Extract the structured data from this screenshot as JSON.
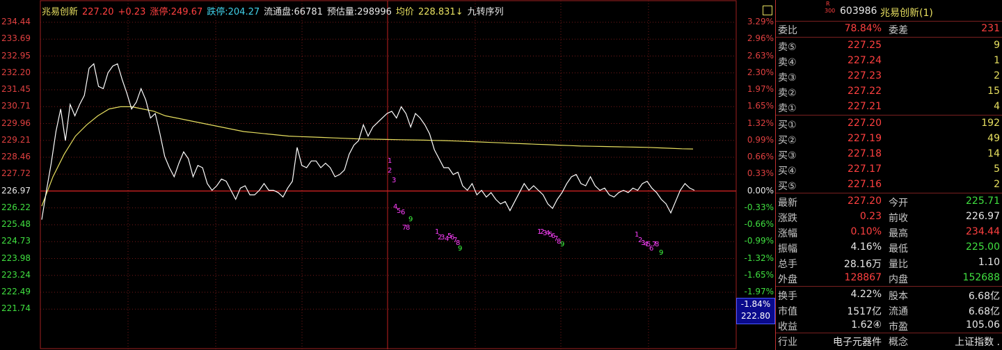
{
  "header": {
    "name": "兆易创新",
    "price": "227.20",
    "change": "+0.23",
    "limit_up_label": "涨停:",
    "limit_up": "249.67",
    "limit_down_label": "跌停:",
    "limit_down": "204.27",
    "float_label": "流通盘:",
    "float": "66781",
    "estimate_label": "预估量:",
    "estimate": "298996",
    "avg_label": "均价",
    "avg": "228.831↓",
    "seq_label": "九转序列"
  },
  "left_axis": [
    "234.44",
    "233.69",
    "232.95",
    "232.20",
    "231.45",
    "230.71",
    "229.96",
    "229.21",
    "228.46",
    "227.72",
    "226.97",
    "226.22",
    "225.48",
    "224.73",
    "223.98",
    "223.24",
    "222.49",
    "221.74"
  ],
  "right_axis": [
    "3.29%",
    "2.96%",
    "2.63%",
    "2.30%",
    "1.97%",
    "1.65%",
    "1.32%",
    "0.99%",
    "0.66%",
    "0.33%",
    "0.00%",
    "-0.33%",
    "-0.66%",
    "-0.99%",
    "-1.32%",
    "-1.65%",
    "-1.97%"
  ],
  "cursor": {
    "pct": "-1.84%",
    "price": "222.80"
  },
  "chart_data": {
    "type": "line",
    "title": "",
    "ylim": [
      221.74,
      234.44
    ],
    "prev_close": 226.97,
    "series": [
      {
        "name": "price",
        "values": [
          225.7,
          227.0,
          228.2,
          229.6,
          230.6,
          229.2,
          230.8,
          230.3,
          230.8,
          231.2,
          232.4,
          232.6,
          231.6,
          231.5,
          232.2,
          232.5,
          232.6,
          231.9,
          231.3,
          230.6,
          230.9,
          231.5,
          231.0,
          230.2,
          230.4,
          229.5,
          228.5,
          228.0,
          227.6,
          228.2,
          228.7,
          228.4,
          227.6,
          228.1,
          228.0,
          227.3,
          227.0,
          227.2,
          227.5,
          227.4,
          227.0,
          226.6,
          227.1,
          227.2,
          226.8,
          226.8,
          227.0,
          227.3,
          227.0,
          227.0,
          226.9,
          226.7,
          227.1,
          227.4,
          228.9,
          228.1,
          228.0,
          228.3,
          228.3,
          228.0,
          228.2,
          228.0,
          227.6,
          227.7,
          227.9,
          228.6,
          229.0,
          229.2,
          229.9,
          229.4,
          229.8,
          230.0,
          230.2,
          230.4,
          230.5,
          230.2,
          230.7,
          230.4,
          229.8,
          230.4,
          230.2,
          229.9,
          229.5,
          228.8,
          228.4,
          228.0,
          228.0,
          227.7,
          227.8,
          227.2,
          227.0,
          227.3,
          226.8,
          227.0,
          226.7,
          226.9,
          226.6,
          226.4,
          226.5,
          226.1,
          226.5,
          226.9,
          227.3,
          227.0,
          227.2,
          227.0,
          226.8,
          226.4,
          226.2,
          226.6,
          226.9,
          227.3,
          227.6,
          227.7,
          227.3,
          227.2,
          227.6,
          227.2,
          227.0,
          227.1,
          226.8,
          226.7,
          226.9,
          227.0,
          226.9,
          227.1,
          227.0,
          227.3,
          227.4,
          227.1,
          226.9,
          226.6,
          226.4,
          226.0,
          226.5,
          227.0,
          227.3,
          227.1,
          227.0
        ]
      },
      {
        "name": "avg",
        "values": [
          226.3,
          227.6,
          228.6,
          229.4,
          229.9,
          230.3,
          230.6,
          230.7,
          230.7,
          230.6,
          230.5,
          230.3,
          230.2,
          230.1,
          230.0,
          229.9,
          229.8,
          229.7,
          229.6,
          229.55,
          229.5,
          229.45,
          229.4,
          229.38,
          229.36,
          229.34,
          229.32,
          229.3,
          229.28,
          229.27,
          229.26,
          229.25,
          229.24,
          229.23,
          229.22,
          229.21,
          229.2,
          229.18,
          229.16,
          229.14,
          229.12,
          229.1,
          229.08,
          229.06,
          229.04,
          229.02,
          229.0,
          228.98,
          228.96,
          228.95,
          228.94,
          228.93,
          228.92,
          228.91,
          228.9,
          228.88,
          228.86,
          228.84,
          228.83
        ]
      }
    ],
    "seq_marks": [
      {
        "group": [
          [
            "1",
            557,
            234,
            "#ff40ff"
          ],
          [
            "2",
            557,
            248,
            "#ff40ff"
          ],
          [
            "3",
            563,
            262,
            "#ff40ff"
          ]
        ]
      },
      {
        "group": [
          [
            "4",
            565,
            300,
            "#ff40ff"
          ],
          [
            "5",
            570,
            306,
            "#ff40ff"
          ],
          [
            "6",
            576,
            308,
            "#ff40ff"
          ],
          [
            "9",
            587,
            318,
            "#40ff40"
          ],
          [
            "7",
            578,
            330,
            "#ff40ff"
          ],
          [
            "8",
            583,
            330,
            "#ff40ff"
          ]
        ]
      },
      {
        "group": [
          [
            "1",
            625,
            336,
            "#ff40ff"
          ],
          [
            "2",
            629,
            344,
            "#ff40ff"
          ],
          [
            "3",
            633,
            344,
            "#ff40ff"
          ],
          [
            "4",
            639,
            346,
            "#ff40ff"
          ],
          [
            "5",
            643,
            342,
            "#ff40ff"
          ],
          [
            "6",
            647,
            344,
            "#ff40ff"
          ],
          [
            "7",
            651,
            348,
            "#ff40ff"
          ],
          [
            "8",
            655,
            352,
            "#ff40ff"
          ],
          [
            "9",
            658,
            360,
            "#40ff40"
          ]
        ]
      },
      {
        "group": [
          [
            "1",
            772,
            336,
            "#ff40ff"
          ],
          [
            "2",
            776,
            336,
            "#ff40ff"
          ],
          [
            "3",
            780,
            338,
            "#ff40ff"
          ],
          [
            "4",
            784,
            338,
            "#ff40ff"
          ],
          [
            "5",
            788,
            340,
            "#ff40ff"
          ],
          [
            "6",
            792,
            342,
            "#ff40ff"
          ],
          [
            "7",
            796,
            346,
            "#ff40ff"
          ],
          [
            "8",
            800,
            350,
            "#ff40ff"
          ],
          [
            "9",
            805,
            354,
            "#40ff40"
          ]
        ]
      },
      {
        "group": [
          [
            "1",
            912,
            340,
            "#ff40ff"
          ],
          [
            "2",
            917,
            348,
            "#ff40ff"
          ],
          [
            "3",
            921,
            352,
            "#ff40ff"
          ],
          [
            "4",
            925,
            354,
            "#ff40ff"
          ],
          [
            "5",
            929,
            354,
            "#ff40ff"
          ],
          [
            "6",
            933,
            360,
            "#ff40ff"
          ],
          [
            "7",
            937,
            354,
            "#ff40ff"
          ],
          [
            "8",
            941,
            354,
            "#ff40ff"
          ],
          [
            "9",
            947,
            366,
            "#40ff40"
          ]
        ]
      }
    ]
  },
  "panel": {
    "code_prefix_top": "R",
    "code_prefix_bottom": "300",
    "code": "603986",
    "name": "兆易创新(1)",
    "wb_label": "委比",
    "wb": "78.84%",
    "wc_label": "委差",
    "wc": "231",
    "asks": [
      {
        "label": "卖⑤",
        "price": "227.25",
        "vol": "9"
      },
      {
        "label": "卖④",
        "price": "227.24",
        "vol": "1"
      },
      {
        "label": "卖③",
        "price": "227.23",
        "vol": "2"
      },
      {
        "label": "卖②",
        "price": "227.22",
        "vol": "15"
      },
      {
        "label": "卖①",
        "price": "227.21",
        "vol": "4"
      }
    ],
    "bids": [
      {
        "label": "买①",
        "price": "227.20",
        "vol": "192"
      },
      {
        "label": "买②",
        "price": "227.19",
        "vol": "49"
      },
      {
        "label": "买③",
        "price": "227.18",
        "vol": "14"
      },
      {
        "label": "买④",
        "price": "227.17",
        "vol": "5"
      },
      {
        "label": "买⑤",
        "price": "227.16",
        "vol": "2"
      }
    ],
    "stats": [
      {
        "l1": "最新",
        "v1": "227.20",
        "c1": "red",
        "l2": "今开",
        "v2": "225.71",
        "c2": "green"
      },
      {
        "l1": "涨跌",
        "v1": "0.23",
        "c1": "red",
        "l2": "前收",
        "v2": "226.97",
        "c2": "wht"
      },
      {
        "l1": "涨幅",
        "v1": "0.10%",
        "c1": "red",
        "l2": "最高",
        "v2": "234.44",
        "c2": "red"
      },
      {
        "l1": "振幅",
        "v1": "4.16%",
        "c1": "wht",
        "l2": "最低",
        "v2": "225.00",
        "c2": "green"
      },
      {
        "l1": "总手",
        "v1": "28.16万",
        "c1": "wht",
        "l2": "量比",
        "v2": "1.10",
        "c2": "wht"
      },
      {
        "l1": "外盘",
        "v1": "128867",
        "c1": "red",
        "l2": "内盘",
        "v2": "152688",
        "c2": "green"
      }
    ],
    "fund": [
      {
        "l1": "换手",
        "v1": "4.22%",
        "l2": "股本",
        "v2": "6.68亿"
      },
      {
        "l1": "市值",
        "v1": "1517亿",
        "l2": "流通",
        "v2": "6.68亿"
      },
      {
        "l1": "收益",
        "v1": "1.62④",
        "l2": "市盈",
        "v2": "105.06"
      }
    ],
    "industry_label": "行业",
    "industry": "电子元器件",
    "concept_label": "概念",
    "index": "上证指数 ."
  }
}
